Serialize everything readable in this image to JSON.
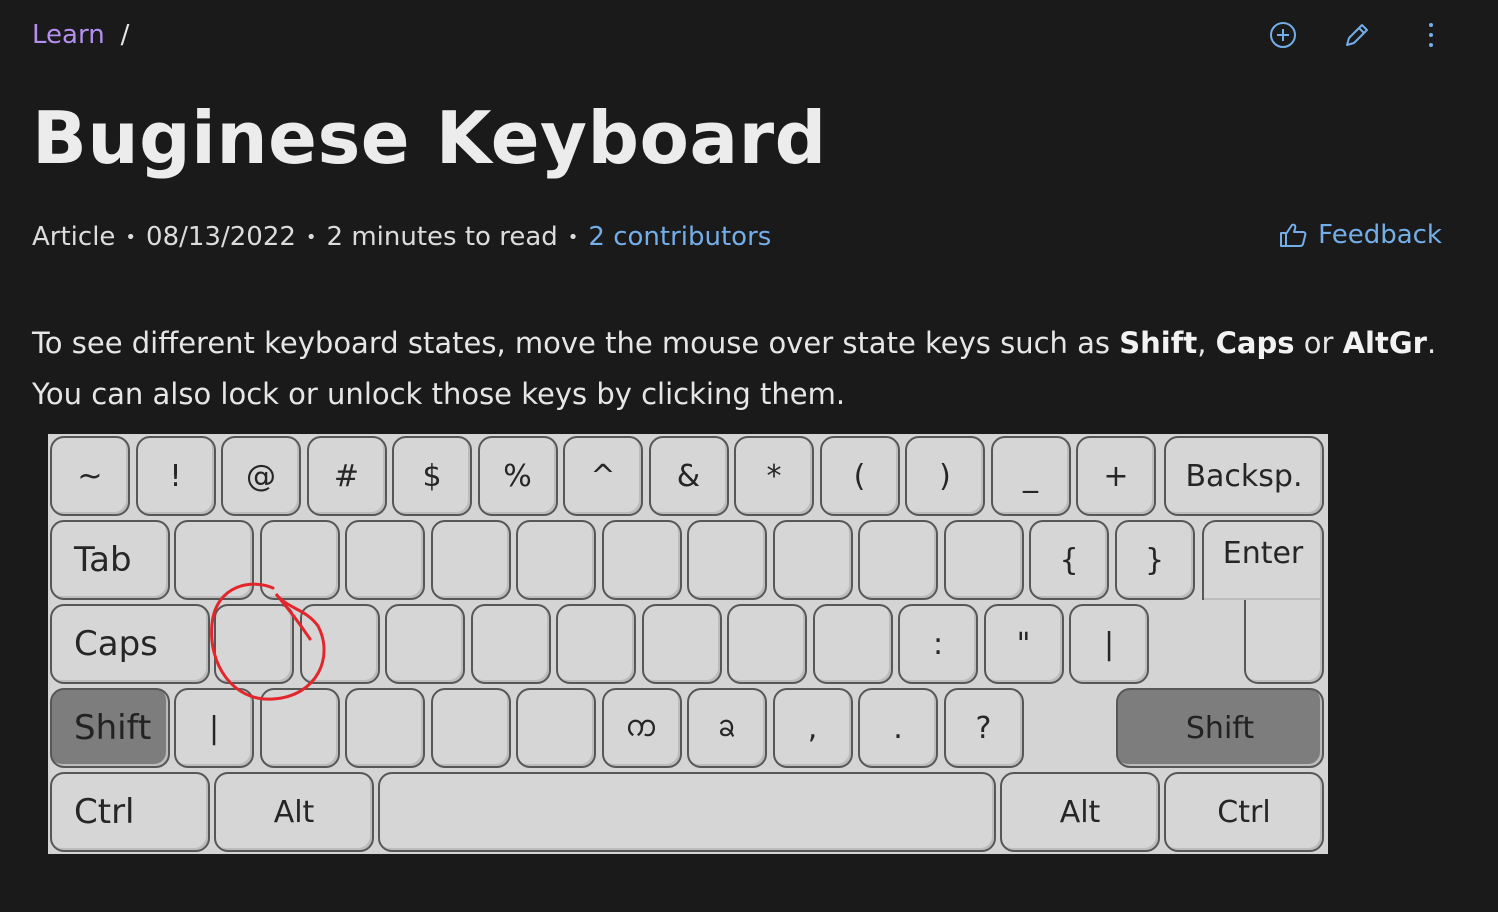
{
  "breadcrumb": {
    "learn": "Learn",
    "separator": "/"
  },
  "actions": {
    "add": "add-circle-icon",
    "edit": "pencil-icon",
    "more": "more-vertical-icon"
  },
  "title": "Buginese Keyboard",
  "meta": {
    "type": "Article",
    "date": "08/13/2022",
    "read_time": "2 minutes to read",
    "contributors": "2 contributors"
  },
  "feedback": {
    "label": "Feedback",
    "icon": "thumbs-up-icon"
  },
  "intro": {
    "text1": "To see different keyboard states, move the mouse over state keys such as ",
    "shift": "Shift",
    "comma": ", ",
    "caps": "Caps",
    "or": " or ",
    "altgr": "AltGr",
    "text2": ". You can also lock or unlock those keys by clicking them."
  },
  "keyboard": {
    "row1": [
      "~",
      "!",
      "@",
      "#",
      "$",
      "%",
      "^",
      "&",
      "*",
      "(",
      ")",
      "_",
      "+"
    ],
    "backspace": "Backsp.",
    "tab": "Tab",
    "row2": [
      "",
      "",
      "",
      "",
      "",
      "",
      "",
      "",
      "",
      "",
      "{",
      "}"
    ],
    "enter": "Enter",
    "caps": "Caps",
    "row3": [
      "",
      "",
      "",
      "",
      "",
      "",
      "",
      "",
      ":",
      "\"",
      "|"
    ],
    "shift_left": "Shift",
    "row4": [
      "|",
      "",
      "",
      "",
      "",
      "ᨠ",
      "ᨡ",
      ",",
      ".",
      "?"
    ],
    "shift_right": "Shift",
    "ctrl_left": "Ctrl",
    "alt_left": "Alt",
    "space": "",
    "alt_right": "Alt",
    "ctrl_right": "Ctrl"
  },
  "colors": {
    "background": "#1a1a1a",
    "link": "#74aee8",
    "breadcrumb": "#b38ff0",
    "annotation": "#e3262b"
  }
}
